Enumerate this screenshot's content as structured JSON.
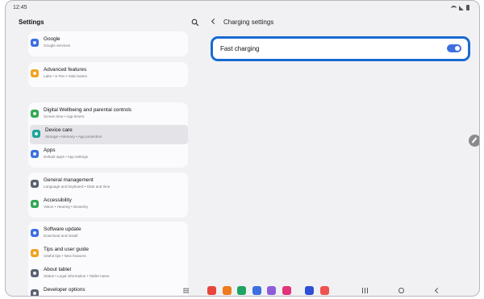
{
  "status_bar": {
    "time": "12:45"
  },
  "left": {
    "title": "Settings",
    "groups": [
      {
        "items": [
          {
            "title": "Google",
            "subtitle": "Google services",
            "icon": "google-icon",
            "color": "#3b6fe2"
          }
        ]
      },
      {
        "items": [
          {
            "title": "Advanced features",
            "subtitle": "Labs  •  S Pen  •  Side button",
            "icon": "advanced-features-icon",
            "color": "#f1a21f"
          }
        ]
      },
      {
        "items": [
          {
            "title": "Digital Wellbeing and parental controls",
            "subtitle": "Screen time  •  App timers",
            "icon": "digital-wellbeing-icon",
            "color": "#32a852"
          },
          {
            "title": "Device care",
            "subtitle": "Storage  •  Memory  •  App protection",
            "icon": "device-care-icon",
            "color": "#1da39a",
            "selected": true
          },
          {
            "title": "Apps",
            "subtitle": "Default apps  •  App settings",
            "icon": "apps-icon",
            "color": "#3b6fe2"
          }
        ]
      },
      {
        "items": [
          {
            "title": "General management",
            "subtitle": "Language and keyboard  •  Date and time",
            "icon": "general-management-icon",
            "color": "#5b6073"
          },
          {
            "title": "Accessibility",
            "subtitle": "Vision  •  Hearing  •  Dexterity",
            "icon": "accessibility-icon",
            "color": "#32a852"
          }
        ]
      },
      {
        "items": [
          {
            "title": "Software update",
            "subtitle": "Download and install",
            "icon": "software-update-icon",
            "color": "#3b6fe2"
          },
          {
            "title": "Tips and user guide",
            "subtitle": "Useful tips  •  New features",
            "icon": "tips-icon",
            "color": "#f1a21f"
          },
          {
            "title": "About tablet",
            "subtitle": "Status  •  Legal information  •  Tablet name",
            "icon": "about-tablet-icon",
            "color": "#5b6073"
          },
          {
            "title": "Developer options",
            "subtitle": "",
            "icon": "developer-options-icon",
            "color": "#5b6073"
          }
        ]
      }
    ]
  },
  "right": {
    "title": "Charging settings",
    "fast_charging": {
      "label": "Fast charging",
      "enabled": true
    }
  },
  "dock": [
    {
      "icon": "app-icon-red",
      "color": "#e8453c"
    },
    {
      "icon": "app-icon-orange",
      "color": "#f07b1d"
    },
    {
      "icon": "app-icon-green",
      "color": "#1fa463"
    },
    {
      "icon": "app-icon-blue",
      "color": "#3b6fe2"
    },
    {
      "icon": "app-icon-purple",
      "color": "#8e5cd9"
    },
    {
      "icon": "app-icon-pink",
      "color": "#e3337a"
    },
    {
      "icon": "app-icon-indigo",
      "color": "#2f4fd6"
    },
    {
      "icon": "app-icon-coral",
      "color": "#ef5350"
    }
  ]
}
